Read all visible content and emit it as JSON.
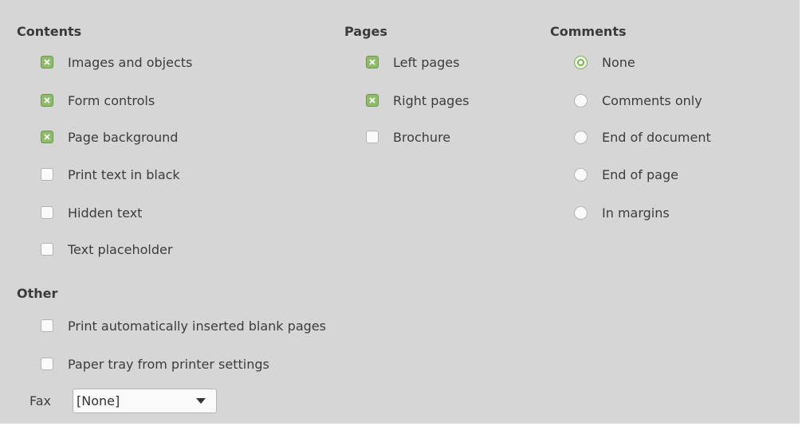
{
  "contents": {
    "title": "Contents",
    "items": [
      {
        "label": "Images and objects",
        "checked": true
      },
      {
        "label": "Form controls",
        "checked": true
      },
      {
        "label": "Page background",
        "checked": true
      },
      {
        "label": "Print text in black",
        "checked": false
      },
      {
        "label": "Hidden text",
        "checked": false
      },
      {
        "label": "Text placeholder",
        "checked": false
      }
    ]
  },
  "pages": {
    "title": "Pages",
    "items": [
      {
        "label": "Left pages",
        "checked": true
      },
      {
        "label": "Right pages",
        "checked": true
      },
      {
        "label": "Brochure",
        "checked": false
      }
    ]
  },
  "comments": {
    "title": "Comments",
    "selected": "None",
    "items": [
      {
        "label": "None",
        "selected": true
      },
      {
        "label": "Comments only",
        "selected": false
      },
      {
        "label": "End of document",
        "selected": false
      },
      {
        "label": "End of page",
        "selected": false
      },
      {
        "label": "In margins",
        "selected": false
      }
    ]
  },
  "other": {
    "title": "Other",
    "items": [
      {
        "label": "Print automatically inserted blank pages",
        "checked": false
      },
      {
        "label": "Paper tray from printer settings",
        "checked": false
      }
    ]
  },
  "fax": {
    "label": "Fax",
    "value": "[None]"
  },
  "colors": {
    "panel_bg": "#d6d6d6",
    "accent_green": "#8fbc6a",
    "text": "#3c3c3c"
  }
}
